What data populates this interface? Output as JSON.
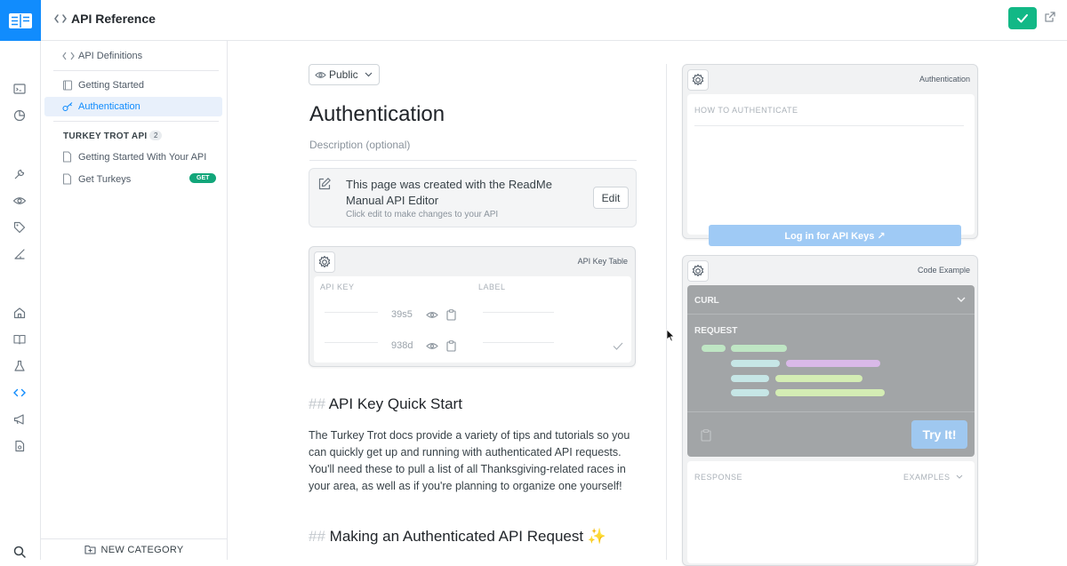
{
  "topbar": {
    "title": "API Reference",
    "colors": {
      "brand": "#118cfd",
      "save": "#12b886"
    }
  },
  "rail": {
    "icons": [
      "log-icon",
      "chart-icon",
      "wrench-icon",
      "eye-icon",
      "tag-icon",
      "pen-ruler-icon",
      "home-icon",
      "book-icon",
      "flask-icon",
      "code-icon",
      "megaphone-icon",
      "document-icon",
      "search-icon"
    ]
  },
  "sidebar": {
    "api_definitions": "API Definitions",
    "items": [
      {
        "label": "Getting Started",
        "icon": "book-icon"
      },
      {
        "label": "Authentication",
        "icon": "key-icon",
        "active": true
      }
    ],
    "category": {
      "title": "TURKEY TROT API",
      "count": "2",
      "items": [
        {
          "label": "Getting Started With Your API",
          "icon": "page-icon"
        },
        {
          "label": "Get Turkeys",
          "icon": "page-icon",
          "badge": "GET"
        }
      ]
    },
    "new_category": "NEW CATEGORY"
  },
  "main": {
    "visibility": "Public",
    "title": "Authentication",
    "description_placeholder": "Description (optional)",
    "notice": {
      "title": "This page was created with the ReadMe Manual API Editor",
      "subtitle": "Click edit to make changes to your API",
      "edit_label": "Edit"
    },
    "key_table": {
      "label": "API Key Table",
      "col_key": "API KEY",
      "col_label": "LABEL",
      "rows": [
        {
          "key": "39s5"
        },
        {
          "key": "938d"
        }
      ]
    },
    "quick_start": {
      "hash": "##",
      "heading": "API Key Quick Start",
      "body": "The Turkey Trot docs provide a variety of tips and tutorials so you can quickly get up and running with authenticated API requests. You'll need these to pull a list of all Thanksgiving-related races in your area, as well as if you're planning to organize one yourself!"
    },
    "making_request": {
      "hash": "##",
      "heading": "Making an Authenticated API Request",
      "emoji": "✨"
    }
  },
  "right": {
    "auth_widget": {
      "label": "Authentication",
      "how_to": "HOW TO AUTHENTICATE",
      "login_label": "Log in for API Keys ↗"
    },
    "code_widget": {
      "label": "Code Example",
      "lang": "CURL",
      "request_label": "REQUEST",
      "try_label": "Try It!",
      "response_label": "RESPONSE",
      "examples_label": "EXAMPLES"
    }
  }
}
